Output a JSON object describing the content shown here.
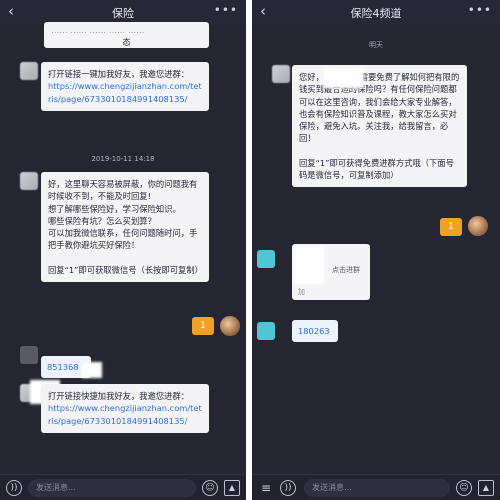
{
  "left": {
    "title": "保险",
    "back_icon": "‹",
    "more_icon": "•••",
    "top_partial_line1": "…… ……          …… …… ……",
    "top_partial_line2": "态",
    "msg1": {
      "text": "打开链接一键加我好友，我邀您进群：",
      "link": "https://www.chengzijianzhan.com/tetris/page/6733010184991408135/"
    },
    "timestamp": "2019-10-11 14:18",
    "msg2": {
      "lines": [
        "好，这里聊天容易被屏蔽，你的问题我有时候收不到，不能及时回复!",
        "想了解哪些保险好，学习保险知识。",
        "哪些保险有坑？怎么买划算？",
        "可以加我微信联系，任何问题随时问，手把手教你避坑买好保险！",
        "",
        "回复“1”即可获取微信号（长按即可复制）"
      ]
    },
    "reply": "1",
    "phone_partial": "851368",
    "msg3": {
      "text": "打开链接快捷加我好友，我邀您进群：",
      "link": "https://www.chengzijianzhan.com/tetris/page/6733010184991408135/"
    },
    "input_placeholder": "发送消息..."
  },
  "right": {
    "title": "保险4频道",
    "back_icon": "‹",
    "more_icon": "•••",
    "faded_top": "明天",
    "msg1": {
      "lines": [
        "您好，                      问您也是需要免费了解如何把有限的钱买到最合适的保险吗？有任何保险问题都可以在这里咨询，我们会给大家专业解答，也会有保险知识普及课程，教大家怎么买对保险，避免入坑。关注我，给我留言，必回！",
        "",
        "回复“1”即可获得免费进群方式哦（下面号码是微信号，可复制添加）"
      ]
    },
    "reply": "1",
    "card": {
      "label": "点击进群",
      "footer": "加"
    },
    "phone_partial": "180263",
    "input_placeholder": "发送消息..."
  },
  "icons": {
    "voice": "voice-icon",
    "emoji": "emoji-icon",
    "image": "image-icon",
    "menu": "menu-icon"
  }
}
